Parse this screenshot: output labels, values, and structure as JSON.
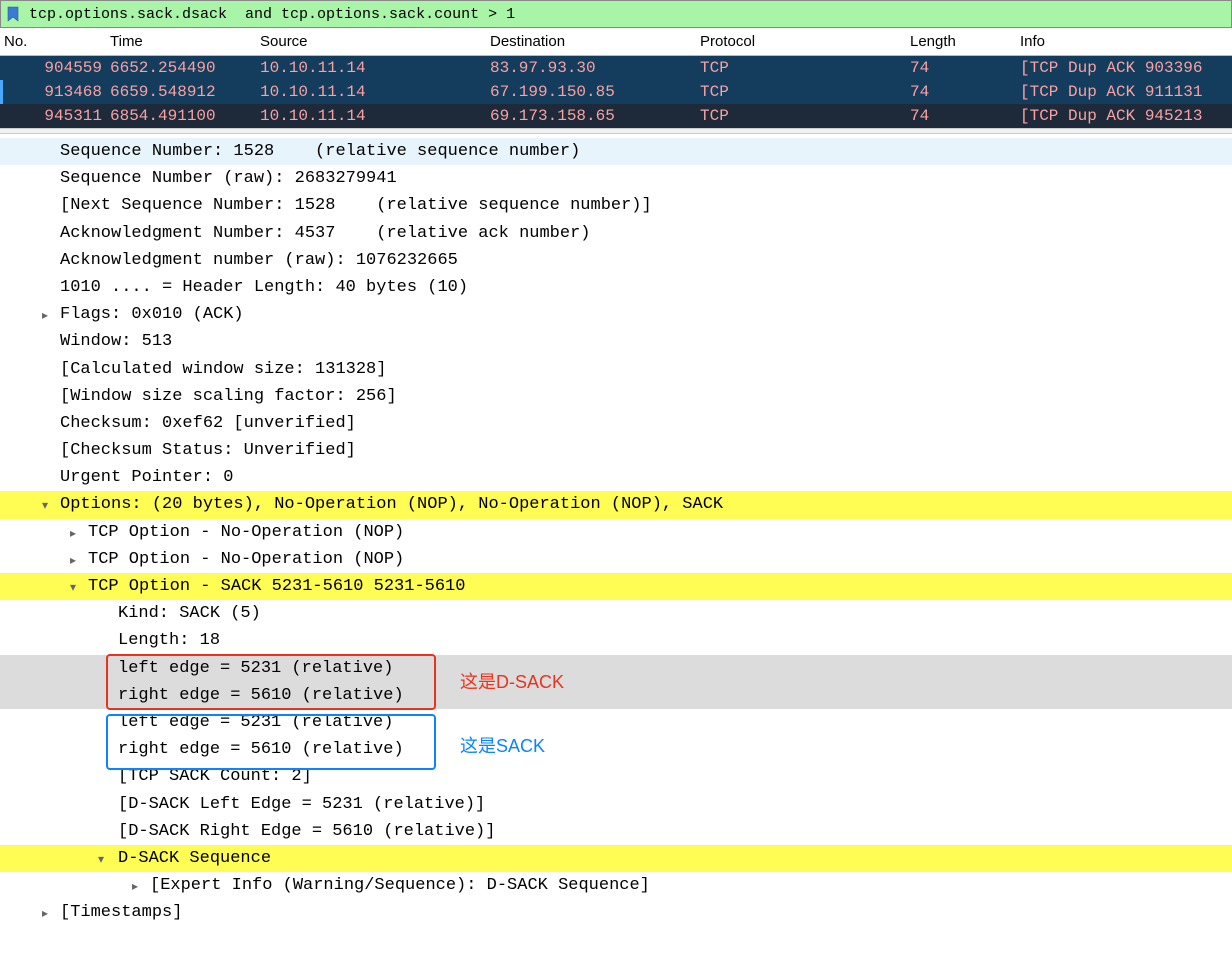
{
  "filter": {
    "text": "tcp.options.sack.dsack  and tcp.options.sack.count > 1"
  },
  "columns": {
    "no": "No.",
    "time": "Time",
    "source": "Source",
    "destination": "Destination",
    "protocol": "Protocol",
    "length": "Length",
    "info": "Info"
  },
  "packets": [
    {
      "no": "904559",
      "time": "6652.254490",
      "src": "10.10.11.14",
      "dst": "83.97.93.30",
      "proto": "TCP",
      "len": "74",
      "info": "[TCP Dup ACK 903396"
    },
    {
      "no": "913468",
      "time": "6659.548912",
      "src": "10.10.11.14",
      "dst": "67.199.150.85",
      "proto": "TCP",
      "len": "74",
      "info": "[TCP Dup ACK 911131"
    },
    {
      "no": "945311",
      "time": "6854.491100",
      "src": "10.10.11.14",
      "dst": "69.173.158.65",
      "proto": "TCP",
      "len": "74",
      "info": "[TCP Dup ACK 945213"
    }
  ],
  "details": {
    "seq_rel": "Sequence Number: 1528    (relative sequence number)",
    "seq_raw": "Sequence Number (raw): 2683279941",
    "next_seq": "[Next Sequence Number: 1528    (relative sequence number)]",
    "ack_rel": "Acknowledgment Number: 4537    (relative ack number)",
    "ack_raw": "Acknowledgment number (raw): 1076232665",
    "hdr_len": "1010 .... = Header Length: 40 bytes (10)",
    "flags": "Flags: 0x010 (ACK)",
    "window": "Window: 513",
    "calc_win": "[Calculated window size: 131328]",
    "scale": "[Window size scaling factor: 256]",
    "checksum": "Checksum: 0xef62 [unverified]",
    "check_status": "[Checksum Status: Unverified]",
    "urgent": "Urgent Pointer: 0",
    "options": "Options: (20 bytes), No-Operation (NOP), No-Operation (NOP), SACK",
    "nop1": "TCP Option - No-Operation (NOP)",
    "nop2": "TCP Option - No-Operation (NOP)",
    "sack_opt": "TCP Option - SACK 5231-5610 5231-5610",
    "kind": "Kind: SACK (5)",
    "length": "Length: 18",
    "le1": "left edge = 5231 (relative)",
    "re1": "right edge = 5610 (relative)",
    "le2": "left edge = 5231 (relative)",
    "re2": "right edge = 5610 (relative)",
    "sack_count": "[TCP SACK Count: 2]",
    "dsack_le": "[D-SACK Left Edge = 5231 (relative)]",
    "dsack_re": "[D-SACK Right Edge = 5610 (relative)]",
    "dsack_seq": "D-SACK Sequence",
    "expert": "[Expert Info (Warning/Sequence): D-SACK Sequence]",
    "timestamps": "[Timestamps]"
  },
  "annotations": {
    "dsack": "这是D-SACK",
    "sack": "这是SACK"
  }
}
